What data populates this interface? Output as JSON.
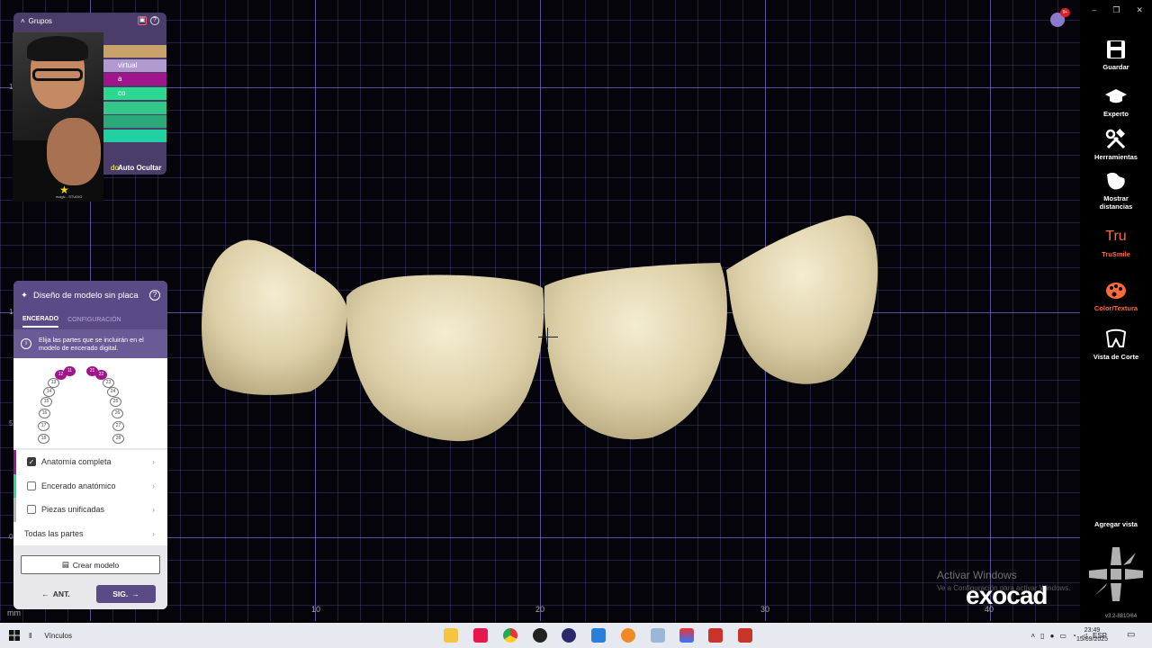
{
  "viewport": {
    "unit_label": "mm",
    "x_ticks": [
      "10",
      "20",
      "30",
      "40"
    ],
    "y_ticks": [
      "1",
      "1",
      "5",
      "0"
    ]
  },
  "groups_panel": {
    "title": "Grupos",
    "rows": [
      {
        "label": "",
        "color": "#c8a26a"
      },
      {
        "label": "virtual",
        "color": "#b09ad0"
      },
      {
        "label": "a",
        "color": "#a0148c"
      },
      {
        "label": "co",
        "color": "#2bd890"
      },
      {
        "label": "",
        "color": "#33c88a"
      },
      {
        "label": "",
        "color": "#2aa87a"
      },
      {
        "label": "",
        "color": "#20d0a0"
      }
    ],
    "auto_prefix": "do",
    "auto_hide_label": "Auto Ocultar"
  },
  "webcam": {
    "brand_text": "magic - STUDIO"
  },
  "design_panel": {
    "title": "Diseño de modelo sin placa",
    "tabs": [
      {
        "label": "ENCERADO",
        "active": true
      },
      {
        "label": "CONFIGURACIÓN",
        "active": false
      }
    ],
    "info_text": "Elija las partes que se incluirán en el modelo de encerado digital.",
    "teeth": [
      {
        "n": "18",
        "sel": false
      },
      {
        "n": "17",
        "sel": false
      },
      {
        "n": "16",
        "sel": false
      },
      {
        "n": "15",
        "sel": false
      },
      {
        "n": "14",
        "sel": false
      },
      {
        "n": "13",
        "sel": false
      },
      {
        "n": "12",
        "sel": true
      },
      {
        "n": "11",
        "sel": true
      },
      {
        "n": "21",
        "sel": true
      },
      {
        "n": "22",
        "sel": true
      },
      {
        "n": "23",
        "sel": false
      },
      {
        "n": "24",
        "sel": false
      },
      {
        "n": "25",
        "sel": false
      },
      {
        "n": "26",
        "sel": false
      },
      {
        "n": "27",
        "sel": false
      },
      {
        "n": "28",
        "sel": false
      }
    ],
    "options": [
      {
        "label": "Anatomía completa",
        "checked": true,
        "accent": "#a0148c"
      },
      {
        "label": "Encerado anatómico",
        "checked": false,
        "accent": "#2bd890"
      },
      {
        "label": "Piezas unificadas",
        "checked": false,
        "accent": "#bbbbbb"
      },
      {
        "label": "Todas las partes",
        "checked": null,
        "accent": ""
      }
    ],
    "create_button": "Crear modelo",
    "prev_button": "ANT.",
    "next_button": "SIG."
  },
  "toolbar": {
    "items": [
      {
        "label": "Guardar",
        "icon": "save-icon"
      },
      {
        "label": "Experto",
        "icon": "graduation-cap-icon"
      },
      {
        "label": "Herramientas",
        "icon": "tools-icon"
      },
      {
        "label": "Mostrar distancias",
        "icon": "distance-icon"
      },
      {
        "label": "TruSmile",
        "icon": "trusmile-icon"
      },
      {
        "label": "Color/Textura",
        "icon": "palette-icon"
      },
      {
        "label": "Vista de Corte",
        "icon": "cut-view-icon"
      }
    ],
    "add_view": "Agregar vista",
    "trusmile_glyph": "Tru"
  },
  "notification": {
    "badge": "9+"
  },
  "watermark": {
    "line1": "Activar Windows",
    "line2": "Ve a Configuración para activar Windows."
  },
  "brand": {
    "logo": "exocad",
    "version": "v3.2-8810/64"
  },
  "taskbar": {
    "links_label": "Vínculos",
    "language": "ESP",
    "time": "23:49",
    "date": "15/09/2025"
  },
  "colors": {
    "accent": "#5a4a85",
    "tooth": "#e8dcb5",
    "grid": "#8c78e6",
    "selected_tooth": "#a0148c"
  }
}
